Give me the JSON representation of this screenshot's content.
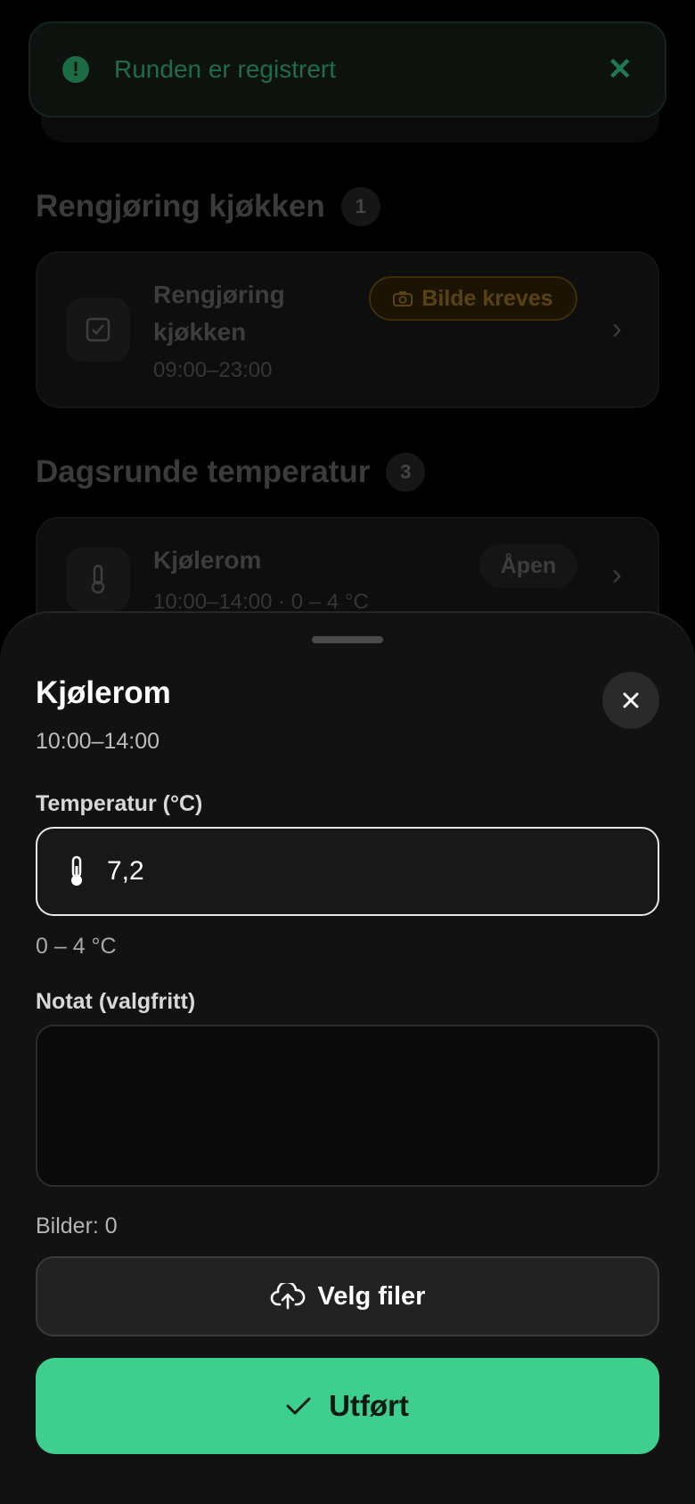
{
  "toast": {
    "message": "Runden er registrert",
    "icon": "alert-circle-icon",
    "close_icon": "close-icon",
    "color": "#1f6c48"
  },
  "sections": [
    {
      "title": "Rengjøring kjøkken",
      "count": "1",
      "cards": [
        {
          "title_line1": "Rengjøring",
          "title_line2": "kjøkken",
          "time": "09:00–23:00",
          "badge": "Bilde kreves",
          "icon": "checkbox-icon"
        }
      ]
    },
    {
      "title": "Dagsrunde temperatur",
      "count": "3",
      "cards": [
        {
          "title": "Kjølerom",
          "details": "10:00–14:00 · 0 – 4 °C",
          "badge": "Åpen",
          "icon": "thermometer-icon"
        }
      ]
    }
  ],
  "sheet": {
    "title": "Kjølerom",
    "time": "10:00–14:00",
    "temperature_label": "Temperatur (°C)",
    "temperature_value": "7,2",
    "range_hint": "0 – 4 °C",
    "note_label": "Notat (valgfritt)",
    "note_value": "",
    "images_count": "Bilder: 0",
    "upload_label": "Velg filer",
    "done_label": "Utført"
  },
  "colors": {
    "accent": "#3ecf8e",
    "background": "#000000",
    "sheet": "#121212"
  }
}
